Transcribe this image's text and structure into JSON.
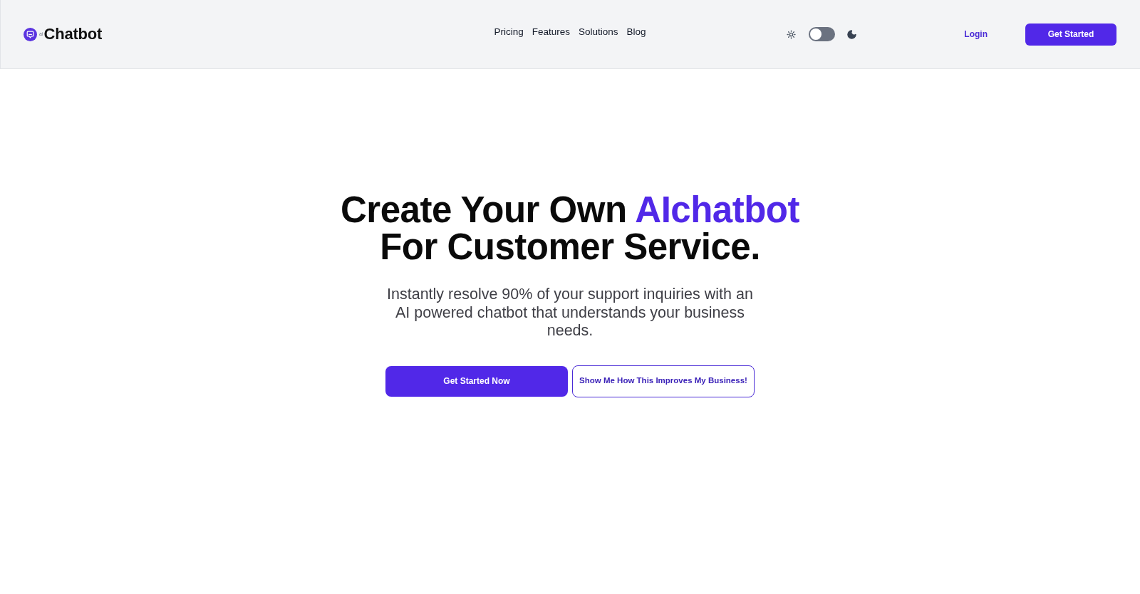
{
  "header": {
    "logo": {
      "badge": "ai",
      "name": "Chatbot"
    },
    "nav": [
      "Pricing",
      "Features",
      "Solutions",
      "Blog"
    ],
    "theme_toggle": {
      "on": false
    },
    "login": "Login",
    "cta": "Get Started"
  },
  "hero": {
    "headline": {
      "lines": [
        {
          "parts": [
            {
              "text": "Create Your Own",
              "highlight": false
            },
            {
              "text": "AIchatbot",
              "highlight": true
            }
          ]
        },
        {
          "parts": [
            {
              "text": "For Customer Service.",
              "highlight": false
            }
          ]
        }
      ]
    },
    "subtitle": "Instantly resolve 90% of your support inquiries with an AI powered chatbot that understands your business needs.",
    "buttons": [
      {
        "label": "Get Started Now",
        "kind": "primary"
      },
      {
        "label": "Show Me How This Improves My Business!",
        "kind": "outline"
      }
    ]
  }
}
